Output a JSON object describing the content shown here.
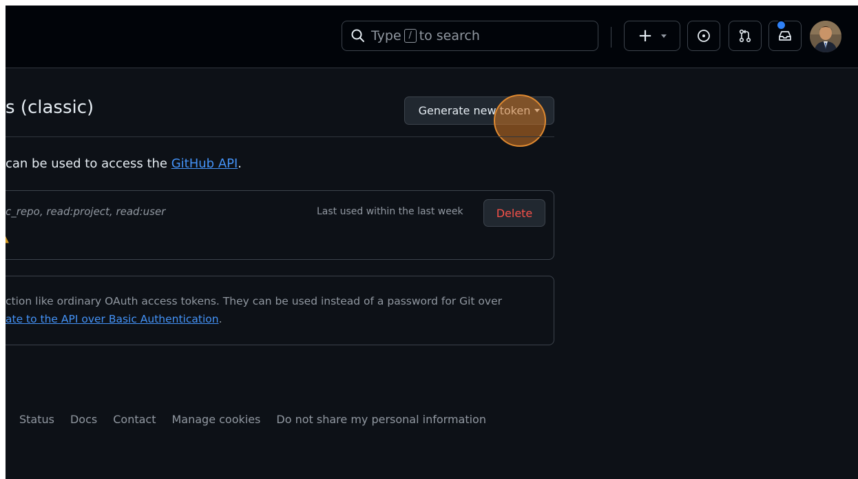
{
  "header": {
    "search_prefix": "Type",
    "search_key": "/",
    "search_suffix": "to search",
    "create_label": "+"
  },
  "main": {
    "title": "s (classic)",
    "generate_button": "Generate new token",
    "intro_prefix": "can be used to access the ",
    "intro_link": "GitHub API",
    "intro_suffix": ".",
    "token": {
      "scopes": "c_repo, read:project, read:user",
      "last_used": "Last used within the last week",
      "delete_label": "Delete"
    },
    "info": {
      "line1": "ction like ordinary OAuth access tokens. They can be used instead of a password for Git over",
      "line2_link": "ate to the API over Basic Authentication",
      "line2_suffix": "."
    }
  },
  "footer": {
    "links": [
      "Status",
      "Docs",
      "Contact",
      "Manage cookies",
      "Do not share my personal information"
    ]
  },
  "colors": {
    "background": "#0d1117",
    "header_bg": "#010409",
    "link": "#4493f8",
    "danger": "#f85149",
    "click_marker": "#e08a30"
  }
}
